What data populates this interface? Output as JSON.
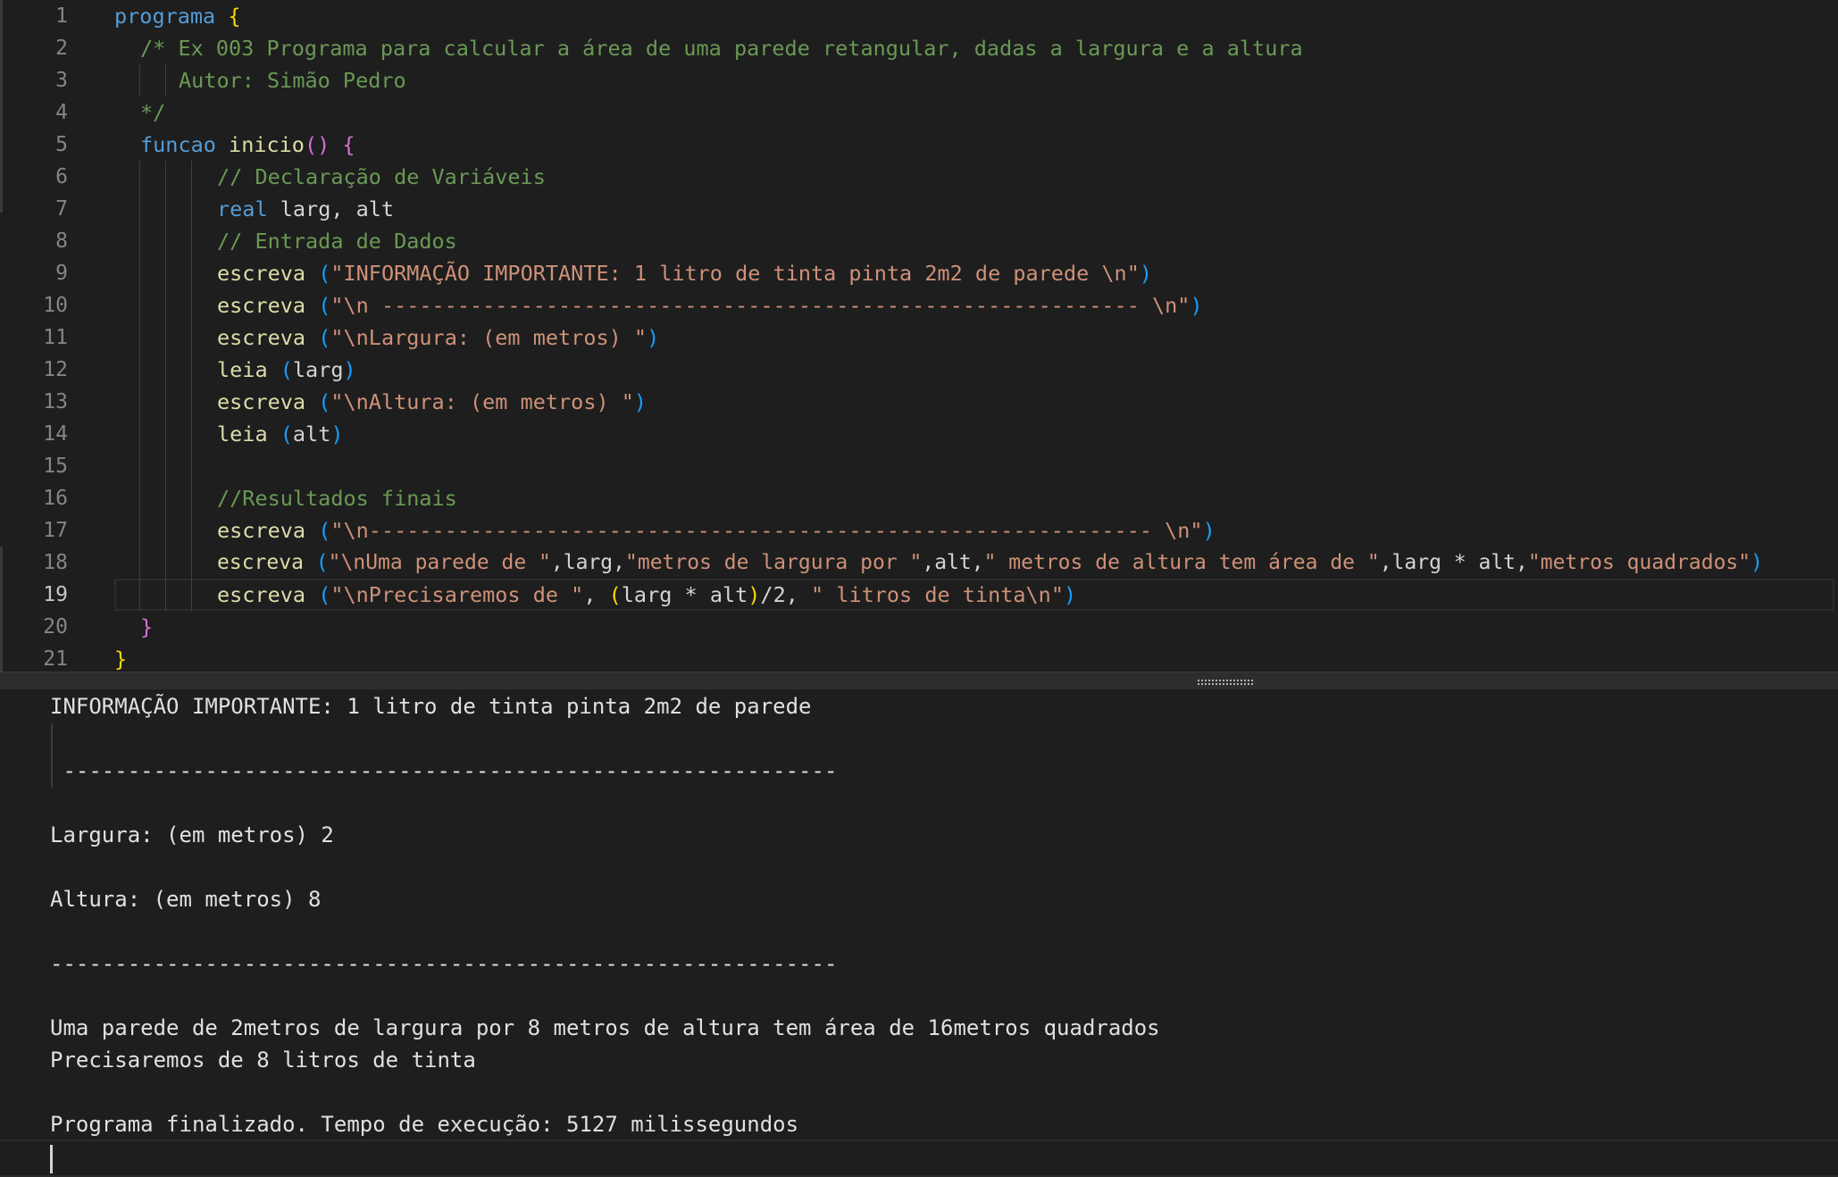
{
  "editor": {
    "line_numbers": [
      "1",
      "2",
      "3",
      "4",
      "5",
      "6",
      "7",
      "8",
      "9",
      "10",
      "11",
      "12",
      "13",
      "14",
      "15",
      "16",
      "17",
      "18",
      "19",
      "20",
      "21"
    ],
    "lines": {
      "l1": {
        "kw": "programa",
        "brace": "{"
      },
      "l2": {
        "comment": "/* Ex 003 Programa para calcular a área de uma parede retangular, dadas a largura e a altura"
      },
      "l3": {
        "comment": "Autor: Simão Pedro"
      },
      "l4": {
        "comment": "*/"
      },
      "l5": {
        "kw": "funcao",
        "name": "inicio",
        "parens": "()",
        "brace": "{"
      },
      "l6": {
        "comment": "// Declaração de Variáveis"
      },
      "l7": {
        "kw": "real",
        "rest": "larg, alt"
      },
      "l8": {
        "comment": "// Entrada de Dados"
      },
      "l9": {
        "call": "escreva",
        "open": "(",
        "str": "\"INFORMAÇÃO IMPORTANTE: 1 litro de tinta pinta 2m2 de parede \\n\"",
        "close": ")"
      },
      "l10": {
        "call": "escreva",
        "open": "(",
        "str": "\"\\n ------------------------------------------------------------ \\n\"",
        "close": ")"
      },
      "l11": {
        "call": "escreva",
        "open": "(",
        "str": "\"\\nLargura: (em metros) \"",
        "close": ")"
      },
      "l12": {
        "call": "leia",
        "open": "(",
        "arg": "larg",
        "close": ")"
      },
      "l13": {
        "call": "escreva",
        "open": "(",
        "str": "\"\\nAltura: (em metros) \"",
        "close": ")"
      },
      "l14": {
        "call": "leia",
        "open": "(",
        "arg": "alt",
        "close": ")"
      },
      "l16": {
        "comment": "//Resultados finais"
      },
      "l17": {
        "call": "escreva",
        "open": "(",
        "str": "\"\\n-------------------------------------------------------------- \\n\"",
        "close": ")"
      },
      "l18": {
        "call": "escreva",
        "open": "(",
        "s1": "\"\\nUma parede de \"",
        "v1": ",larg,",
        "s2": "\"metros de largura por \"",
        "v2": ",alt,",
        "s3": "\" metros de altura tem área de \"",
        "v3": ",larg * alt,",
        "s4": "\"metros quadrados\"",
        "close": ")"
      },
      "l19": {
        "call": "escreva",
        "open": "(",
        "s1": "\"\\nPrecisaremos de \"",
        "v1": ", ",
        "p_open": "(",
        "v2": "larg * alt",
        "p_close": ")",
        "v3": "/2, ",
        "s2": "\" litros de tinta\\n\"",
        "close": ")"
      },
      "l20": {
        "brace": "}"
      },
      "l21": {
        "brace": "}"
      }
    }
  },
  "console": {
    "lines": [
      "INFORMAÇÃO IMPORTANTE: 1 litro de tinta pinta 2m2 de parede",
      "",
      " ------------------------------------------------------------",
      "",
      "Largura: (em metros) 2",
      "",
      "Altura: (em metros) 8",
      "",
      "-------------------------------------------------------------",
      "",
      "Uma parede de 2metros de largura por 8 metros de altura tem área de 16metros quadrados",
      "Precisaremos de 8 litros de tinta",
      "",
      "Programa finalizado. Tempo de execução: 5127 milissegundos"
    ]
  },
  "colors": {
    "background": "#1e1e1e",
    "keyword": "#569cd6",
    "function": "#dcdcaa",
    "string": "#ce9178",
    "comment": "#6a9955",
    "bracket_level1": "#ffd700",
    "bracket_level2": "#da70d6",
    "bracket_level3": "#179fff"
  }
}
